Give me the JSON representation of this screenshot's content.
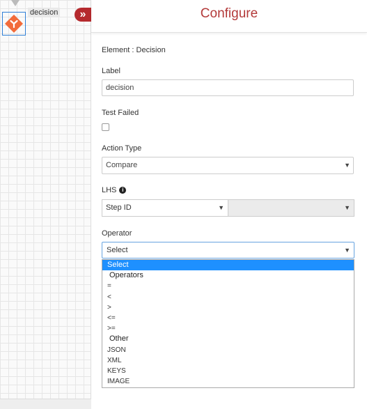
{
  "canvas": {
    "node_label": "decision",
    "node_icon": "decision-fork-icon",
    "node_color": "#f26b3a",
    "collapse_icon": "double-chevron-right-icon",
    "collapse_symbol": "»"
  },
  "panel": {
    "title": "Configure",
    "element_text": "Element : Decision",
    "label_field": {
      "label": "Label",
      "value": "decision"
    },
    "test_failed": {
      "label": "Test Failed",
      "checked": false
    },
    "action_type": {
      "label": "Action Type",
      "value": "Compare"
    },
    "lhs": {
      "label": "LHS",
      "value": "Step ID",
      "info_icon": "info-circle-icon",
      "info_glyph": "i"
    },
    "operator": {
      "label": "Operator",
      "value": "Select",
      "options": {
        "selected": "Select",
        "group1": "Operators",
        "op1": "=",
        "op2": "<",
        "op3": ">",
        "op4": "<=",
        "op5": ">=",
        "group2": "Other",
        "other1": "JSON",
        "other2": "XML",
        "other3": "KEYS",
        "other4": "IMAGE"
      }
    },
    "caret": "▼"
  },
  "colors": {
    "accent": "#b52a2e",
    "title": "#b33a3a",
    "highlight": "#1e90ff"
  }
}
